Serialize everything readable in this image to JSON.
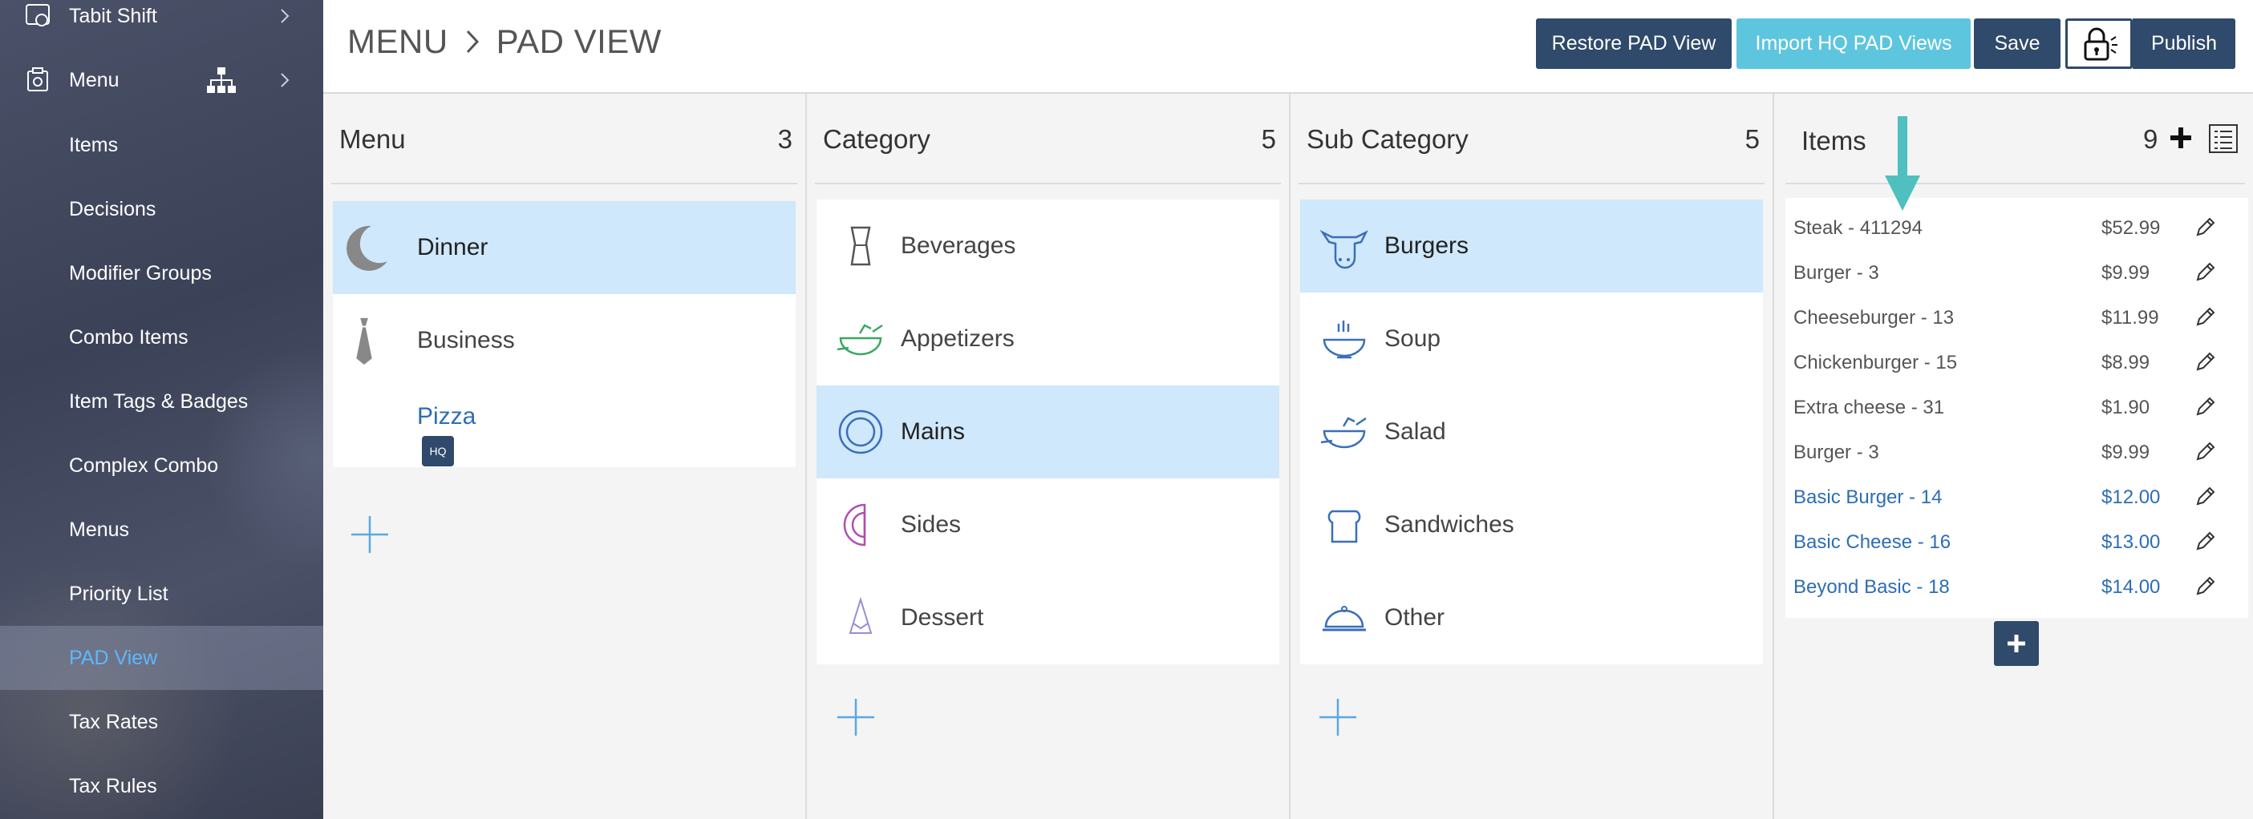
{
  "sidebar": {
    "tabit_shift": "Tabit Shift",
    "menu": "Menu",
    "items": [
      "Items",
      "Decisions",
      "Modifier Groups",
      "Combo Items",
      "Item Tags & Badges",
      "Complex Combo",
      "Menus",
      "Priority List",
      "PAD View",
      "Tax Rates",
      "Tax Rules"
    ],
    "active": "PAD View"
  },
  "header": {
    "breadcrumb_root": "MENU",
    "breadcrumb_current": "PAD VIEW",
    "restore_label": "Restore PAD View",
    "import_label": "Import HQ PAD Views",
    "save_label": "Save",
    "publish_label": "Publish",
    "lock_icon": "lock-icon"
  },
  "columns": {
    "menu": {
      "title": "Menu",
      "count": "3",
      "rows": [
        {
          "label": "Dinner",
          "icon": "moon-icon",
          "selected": true
        },
        {
          "label": "Business",
          "icon": "tie-icon",
          "selected": false
        },
        {
          "label": "Pizza",
          "icon": "",
          "selected": false,
          "badge": "HQ"
        }
      ]
    },
    "category": {
      "title": "Category",
      "count": "5",
      "rows": [
        {
          "label": "Beverages",
          "icon": "glass-icon"
        },
        {
          "label": "Appetizers",
          "icon": "salad-bowl-icon"
        },
        {
          "label": "Mains",
          "icon": "plate-icon",
          "selected": true
        },
        {
          "label": "Sides",
          "icon": "half-plate-icon"
        },
        {
          "label": "Dessert",
          "icon": "cake-slice-icon"
        }
      ]
    },
    "subcategory": {
      "title": "Sub Category",
      "count": "5",
      "rows": [
        {
          "label": "Burgers",
          "icon": "cow-icon",
          "selected": true
        },
        {
          "label": "Soup",
          "icon": "soup-bowl-icon"
        },
        {
          "label": "Salad",
          "icon": "salad-bowl-icon"
        },
        {
          "label": "Sandwiches",
          "icon": "bread-icon"
        },
        {
          "label": "Other",
          "icon": "cloche-icon"
        }
      ]
    }
  },
  "items": {
    "title": "Items",
    "count": "9",
    "rows": [
      {
        "name": "Steak  -  411294",
        "price": "$52.99",
        "hq": false
      },
      {
        "name": "Burger  -  3",
        "price": "$9.99",
        "hq": false
      },
      {
        "name": "Cheeseburger  -  13",
        "price": "$11.99",
        "hq": false
      },
      {
        "name": "Chickenburger  -  15",
        "price": "$8.99",
        "hq": false
      },
      {
        "name": "Extra cheese  -  31",
        "price": "$1.90",
        "hq": false
      },
      {
        "name": "Burger  -  3",
        "price": "$9.99",
        "hq": false
      },
      {
        "name": "Basic Burger  -  14",
        "price": "$12.00",
        "hq": true
      },
      {
        "name": "Basic Cheese  -  16",
        "price": "$13.00",
        "hq": true
      },
      {
        "name": "Beyond Basic  -  18",
        "price": "$14.00",
        "hq": true
      }
    ]
  },
  "colors": {
    "primary": "#2f4a6a",
    "import": "#5ec5df",
    "selected_row": "#cfe8fb",
    "link": "#2e6db4",
    "arrow": "#4fbfbf"
  }
}
